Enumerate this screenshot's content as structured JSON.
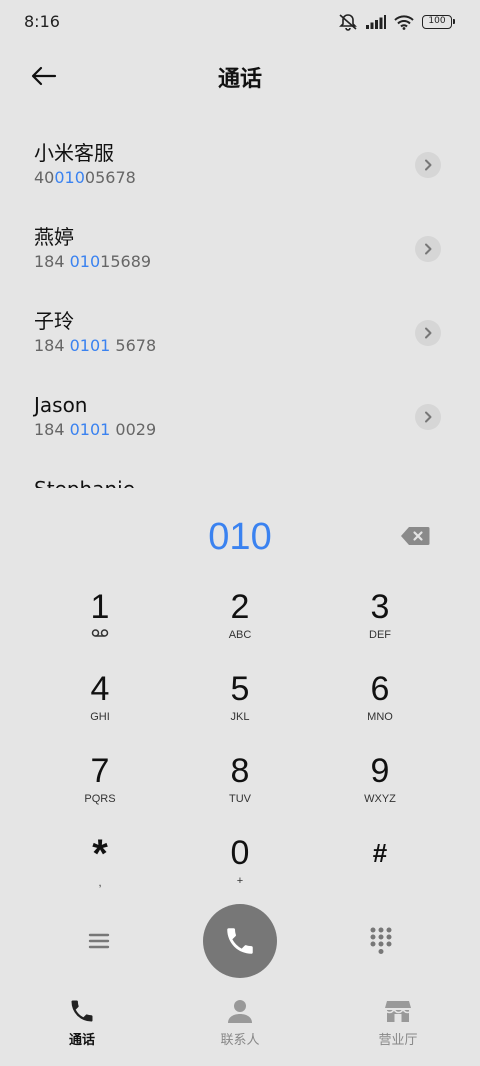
{
  "status_bar": {
    "time": "8:16",
    "battery": "100",
    "icons": [
      "mute-bell-icon",
      "signal-icon",
      "wifi-icon",
      "battery-icon"
    ]
  },
  "header": {
    "title": "通话",
    "back_icon": "arrow-left-icon"
  },
  "results": [
    {
      "name": "小米客服",
      "number_parts": [
        "40",
        "010",
        "05678"
      ]
    },
    {
      "name": "燕婷",
      "number_parts": [
        "184 ",
        "010",
        "15689"
      ]
    },
    {
      "name": "子玲",
      "number_parts": [
        "184 ",
        "0101",
        " 5678"
      ]
    },
    {
      "name": "Jason",
      "number_parts": [
        "184 ",
        "0101",
        " 0029"
      ]
    },
    {
      "name": "Stephanie",
      "number_parts": [
        "",
        "",
        ""
      ]
    }
  ],
  "dialpad": {
    "entered": "010",
    "keys": [
      {
        "digit": "1",
        "sub": ""
      },
      {
        "digit": "2",
        "sub": "ABC"
      },
      {
        "digit": "3",
        "sub": "DEF"
      },
      {
        "digit": "4",
        "sub": "GHI"
      },
      {
        "digit": "5",
        "sub": "JKL"
      },
      {
        "digit": "6",
        "sub": "MNO"
      },
      {
        "digit": "7",
        "sub": "PQRS"
      },
      {
        "digit": "8",
        "sub": "TUV"
      },
      {
        "digit": "9",
        "sub": "WXYZ"
      },
      {
        "digit": "*",
        "sub": ","
      },
      {
        "digit": "0",
        "sub": "+"
      },
      {
        "digit": "#",
        "sub": ""
      }
    ]
  },
  "bottom_nav": [
    {
      "label": "通话",
      "icon": "phone-icon",
      "active": true
    },
    {
      "label": "联系人",
      "icon": "person-icon",
      "active": false
    },
    {
      "label": "营业厅",
      "icon": "store-icon",
      "active": false
    }
  ],
  "colors": {
    "background": "#e5e5e5",
    "accent": "#3a82f0",
    "call_button": "#777777"
  }
}
